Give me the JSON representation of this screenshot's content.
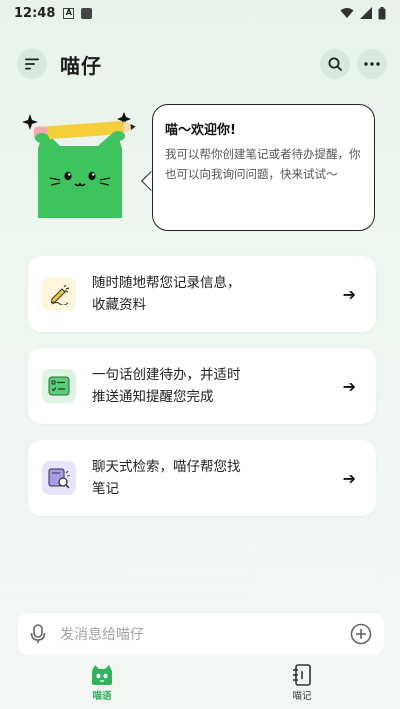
{
  "status_bar": {
    "time": "12:48",
    "icons": [
      "a-notification-icon",
      "square-notification-icon",
      "wifi-icon",
      "signal-icon",
      "battery-icon"
    ]
  },
  "app_bar": {
    "title": "喵仔",
    "menu_icon": "menu-icon",
    "search_icon": "search-icon",
    "more_icon": "more-icon"
  },
  "hero": {
    "greeting": "喵～欢迎你!",
    "intro": "我可以帮你创建笔记或者待办提醒，你也可以向我询问问题，快来试试～"
  },
  "features": [
    {
      "icon": "note-pen-icon",
      "line1": "随时随地帮您记录信息，",
      "line2": "收藏资料"
    },
    {
      "icon": "todo-list-icon",
      "line1": "一句话创建待办，并适时",
      "line2": "推送通知提醒您完成"
    },
    {
      "icon": "search-note-icon",
      "line1": "聊天式检索，喵仔帮您找",
      "line2": "笔记"
    }
  ],
  "composer": {
    "placeholder": "发消息给喵仔",
    "mic_icon": "microphone-icon",
    "add_icon": "plus-circle-icon"
  },
  "tabs": [
    {
      "label": "喵语",
      "icon": "cat-chat-icon",
      "active": true
    },
    {
      "label": "喵记",
      "icon": "notebook-icon",
      "active": false
    }
  ],
  "colors": {
    "accent": "#2fb35c",
    "background": "#eaf4ec",
    "cat_green": "#3ec45f",
    "pencil_yellow": "#f4cf3a"
  }
}
